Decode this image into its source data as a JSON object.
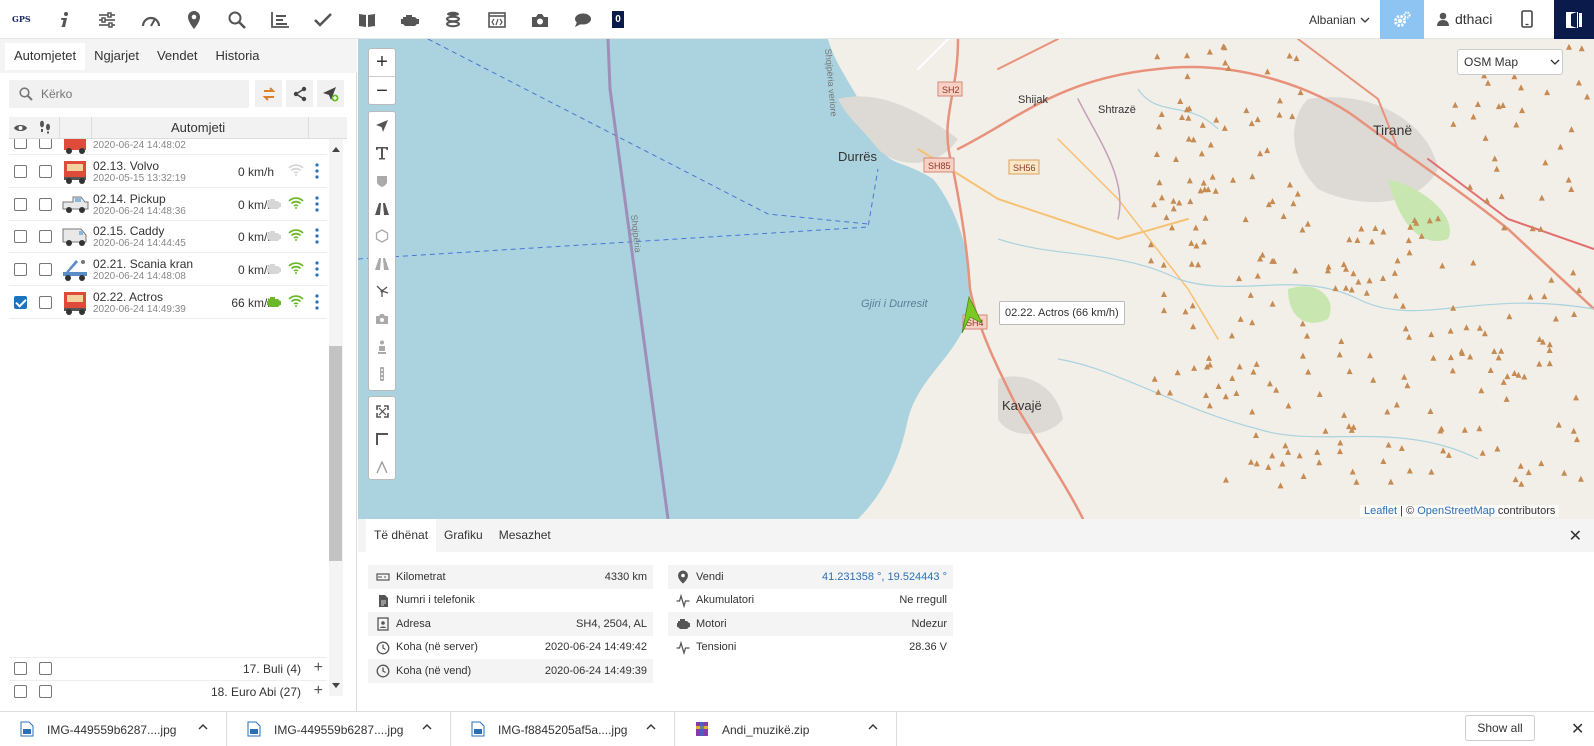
{
  "toolbar": {
    "logo": "GPS",
    "notification_count": "0",
    "language": "Albanian",
    "username": "dthaci",
    "icons": [
      "info-icon",
      "sliders-icon",
      "speedometer-icon",
      "map-pin-icon",
      "search-icon",
      "chart-icon",
      "check-icon",
      "book-icon",
      "engine-icon",
      "fuel-icon",
      "code-window-icon",
      "camera-icon",
      "chat-icon"
    ]
  },
  "left": {
    "tabs": [
      "Automjetet",
      "Ngjarjet",
      "Vendet",
      "Historia"
    ],
    "search_placeholder": "Kërko",
    "column_title": "Automjeti",
    "partial_row_time": "2020-06-24 14:48:02",
    "vehicles": [
      {
        "name": "02.13. Volvo",
        "time": "2020-05-15 13:32:19",
        "speed": "0 km/h",
        "icon": "truck-red-icon",
        "checked": false,
        "engine": false,
        "signal": false
      },
      {
        "name": "02.14. Pickup",
        "time": "2020-06-24 14:48:36",
        "speed": "0 km/h",
        "icon": "pickup-icon",
        "checked": false,
        "engine": false,
        "signal": true
      },
      {
        "name": "02.15. Caddy",
        "time": "2020-06-24 14:44:45",
        "speed": "0 km/h",
        "icon": "van-icon",
        "checked": false,
        "engine": false,
        "signal": true
      },
      {
        "name": "02.21. Scania kran",
        "time": "2020-06-24 14:48:08",
        "speed": "0 km/h",
        "icon": "crane-truck-icon",
        "checked": false,
        "engine": false,
        "signal": true
      },
      {
        "name": "02.22. Actros",
        "time": "2020-06-24 14:49:39",
        "speed": "66 km/h",
        "icon": "truck-red-icon",
        "checked": true,
        "engine": true,
        "signal": true
      }
    ],
    "groups": [
      {
        "name": "17. Buli (4)"
      },
      {
        "name": "18. Euro Abi (27)"
      }
    ]
  },
  "map": {
    "layer": "OSM Map",
    "tooltip": "02.22. Actros (66 km/h)",
    "labels": {
      "durres": "Durrës",
      "tirane": "Tiranë",
      "kavaje": "Kavajë",
      "shijak": "Shijak",
      "shtraze": "Shtrazë",
      "gulf": "Gjiri i Durresit",
      "border": "Shqipëria",
      "verior": "Shqipëria veriore",
      "sh2": "SH2",
      "sh85": "SH85",
      "sh56": "SH56",
      "sh4": "SH4"
    },
    "attribution_leaflet": "Leaflet",
    "attribution_sep": "| ©",
    "attribution_osm": "OpenStreetMap",
    "attribution_tail": "contributors"
  },
  "detail": {
    "tabs": [
      "Të dhënat",
      "Grafiku",
      "Mesazhet"
    ],
    "left_rows": [
      {
        "label": "Kilometrat",
        "value": "4330 km",
        "icon": "odometer-icon"
      },
      {
        "label": "Numri i telefonik",
        "value": "",
        "icon": "document-icon"
      },
      {
        "label": "Adresa",
        "value": "SH4, 2504, AL",
        "icon": "address-icon"
      },
      {
        "label": "Koha (në server)",
        "value": "2020-06-24 14:49:42",
        "icon": "clock-icon"
      },
      {
        "label": "Koha (në vend)",
        "value": "2020-06-24 14:49:39",
        "icon": "clock-icon"
      }
    ],
    "right_rows": [
      {
        "label": "Vendi",
        "value": "41.231358 °, 19.524443 °",
        "icon": "location-icon",
        "link": true
      },
      {
        "label": "Akumulatori",
        "value": "Ne rregull",
        "icon": "pulse-icon",
        "link": false
      },
      {
        "label": "Motori",
        "value": "Ndezur",
        "icon": "engine-icon",
        "link": false
      },
      {
        "label": "Tensioni",
        "value": "28.36 V",
        "icon": "pulse-icon",
        "link": false
      }
    ]
  },
  "downloads": {
    "files": [
      {
        "name": "IMG-449559b6287....jpg",
        "type": "image"
      },
      {
        "name": "IMG-449559b6287....jpg",
        "type": "image"
      },
      {
        "name": "IMG-f8845205af5a....jpg",
        "type": "image"
      },
      {
        "name": "Andi_muzikë.zip",
        "type": "archive"
      }
    ],
    "show_all": "Show all"
  }
}
